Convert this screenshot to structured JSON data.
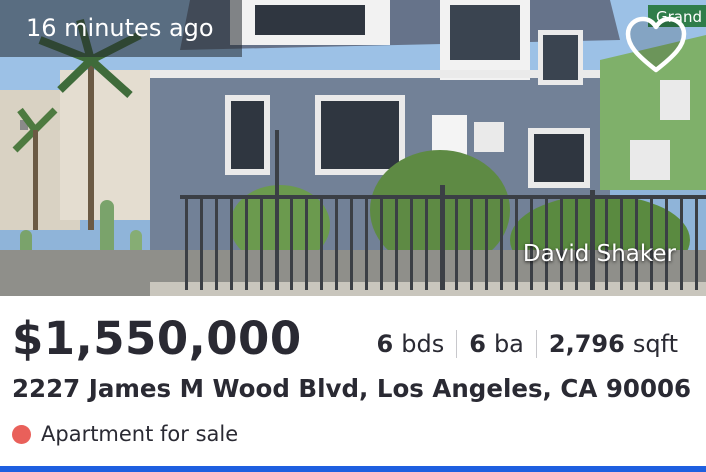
{
  "listing": {
    "time_ago": "16 minutes ago",
    "photo_credit": "David Shaker",
    "street_sign": "Grand",
    "favorite_icon": "heart-outline-icon",
    "price": "$1,550,000",
    "beds_value": "6",
    "beds_unit": "bds",
    "baths_value": "6",
    "baths_unit": "ba",
    "sqft_value": "2,796",
    "sqft_unit": "sqft",
    "address": "2227 James M Wood Blvd, Los Angeles, CA 90006",
    "status": "Apartment for sale",
    "status_color": "#e9605a",
    "accent_color": "#1e5fe0"
  }
}
